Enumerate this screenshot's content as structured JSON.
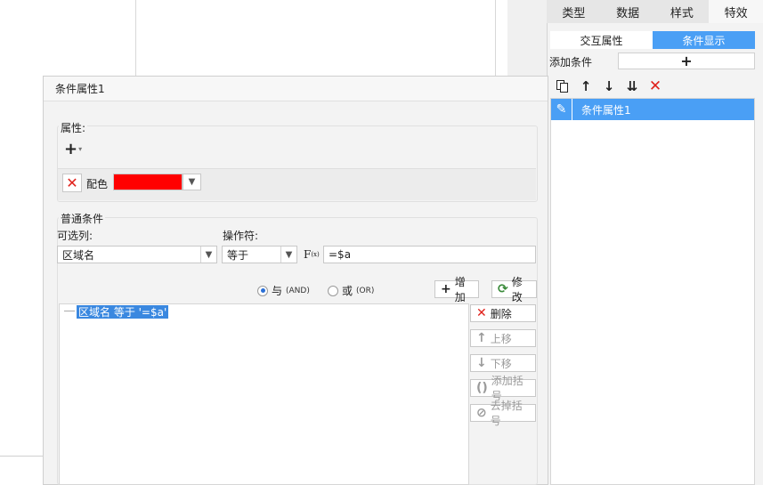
{
  "right_panel": {
    "tabs": [
      "类型",
      "数据",
      "样式",
      "特效"
    ],
    "active_tab": "特效",
    "subtabs": [
      "交互属性",
      "条件显示"
    ],
    "active_subtab": "条件显示",
    "add_condition_label": "添加条件",
    "add_condition_button": "+",
    "list_items": [
      "条件属性1"
    ]
  },
  "dialog": {
    "title": "条件属性1",
    "attribute_group_label": "属性:",
    "add_attribute_button": "+",
    "color_label": "配色",
    "color_value": "#ff0000",
    "condition_group_label": "普通条件",
    "column_label": "可选列:",
    "column_value": "区域名",
    "operator_label": "操作符:",
    "operator_value": "等于",
    "formula_icon_label": "F(x)",
    "value_input": "=$a",
    "radio_and": "与",
    "radio_and_sub": "(AND)",
    "radio_or": "或",
    "radio_or_sub": "(OR)",
    "and_selected": true,
    "buttons": {
      "add": "增加",
      "edit": "修改",
      "delete": "删除",
      "move_up": "上移",
      "move_down": "下移",
      "add_bracket": "添加括号",
      "remove_bracket": "去掉括号"
    },
    "conditions": [
      "区域名 等于 '=$a'"
    ]
  },
  "colors": {
    "accent": "#4a9ff5",
    "selection": "#3a88e0",
    "delete_red": "#e0211b"
  }
}
